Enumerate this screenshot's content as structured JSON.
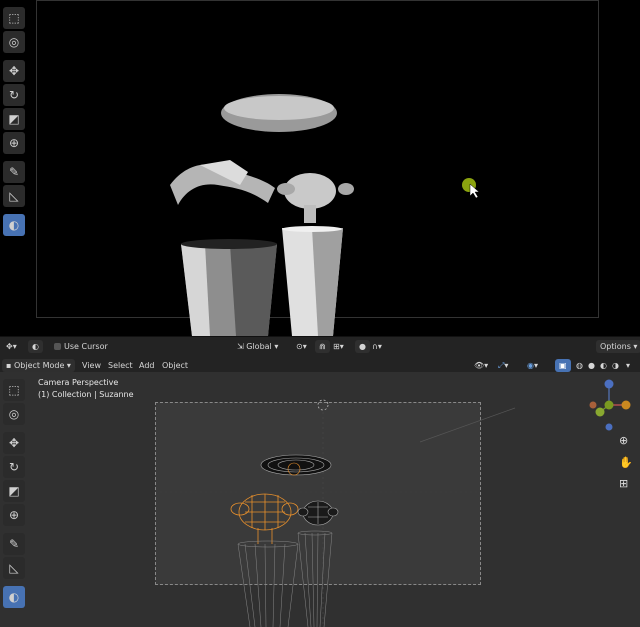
{
  "tool_settings": {
    "use_cursor_label": "Use Cursor",
    "transform_orientation": "Global",
    "options_label": "Options"
  },
  "viewport_header": {
    "mode": "Object Mode",
    "menus": [
      "View",
      "Select",
      "Add",
      "Object"
    ]
  },
  "viewport_overlay": {
    "view_name": "Camera Perspective",
    "collection_info": "(1) Collection | Suzanne"
  },
  "colors": {
    "active_tool": "#4772b3",
    "selection_orange": "#e8902c",
    "cursor_dot": "#8ba30f"
  },
  "icons": {
    "toolbar": [
      "select-box-icon",
      "cursor-icon",
      "move-icon",
      "rotate-icon",
      "scale-icon",
      "transform-icon",
      "annotate-icon",
      "measure-icon",
      "grease-pencil-icon"
    ],
    "nav": [
      "zoom-icon",
      "pan-hand-icon",
      "camera-view-icon"
    ]
  }
}
